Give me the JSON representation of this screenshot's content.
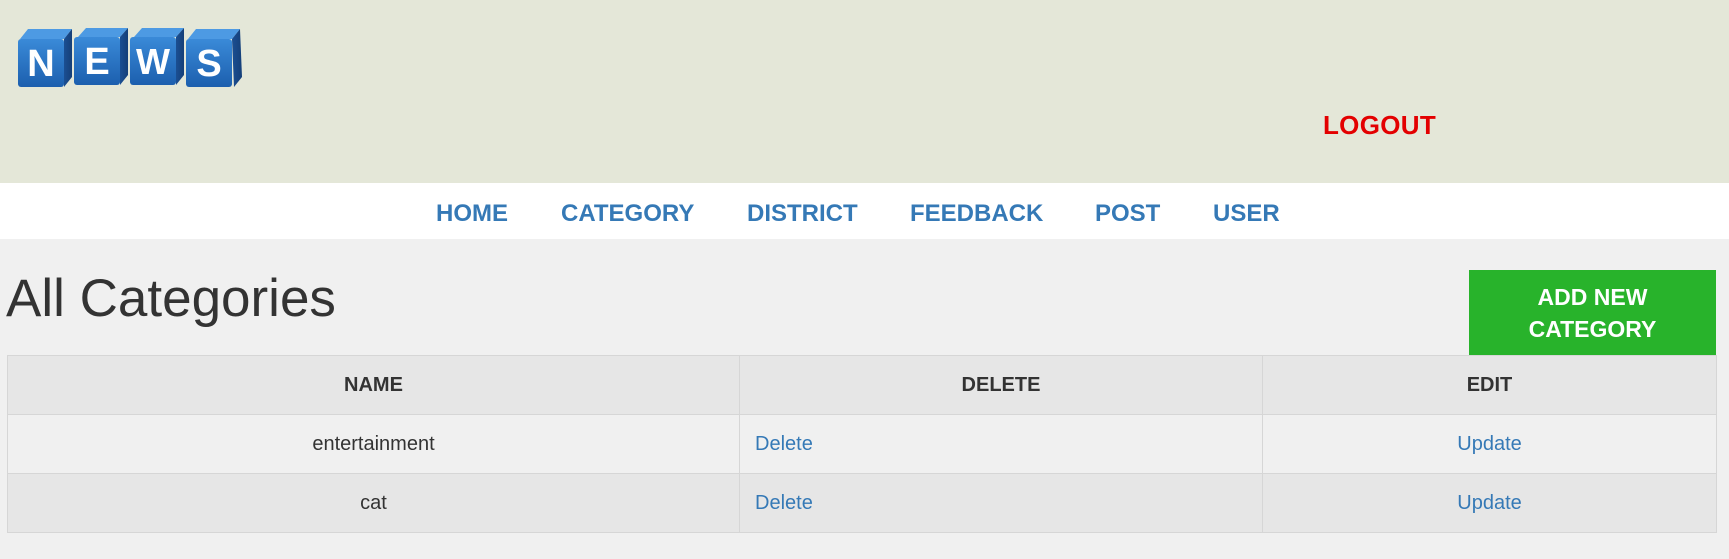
{
  "colors": {
    "header_bg": "#e4e7d8",
    "nav_link": "#3579b6",
    "logout": "#e30000",
    "add_button": "#28b32b",
    "page_bg": "#f0f0f0"
  },
  "header": {
    "logo": {
      "icon": "news-cubes-logo",
      "letters": [
        "N",
        "E",
        "W",
        "S"
      ]
    },
    "logout_label": "LOGOUT"
  },
  "nav": {
    "items": [
      {
        "label": "HOME"
      },
      {
        "label": "CATEGORY"
      },
      {
        "label": "DISTRICT"
      },
      {
        "label": "FEEDBACK"
      },
      {
        "label": "POST"
      },
      {
        "label": "USER"
      }
    ]
  },
  "main": {
    "title": "All Categories",
    "add_button_label": "ADD NEW CATEGORY",
    "table": {
      "headers": [
        "NAME",
        "DELETE",
        "EDIT"
      ],
      "rows": [
        {
          "name": "entertainment",
          "delete": "Delete",
          "edit": "Update"
        },
        {
          "name": "cat",
          "delete": "Delete",
          "edit": "Update"
        }
      ]
    }
  }
}
